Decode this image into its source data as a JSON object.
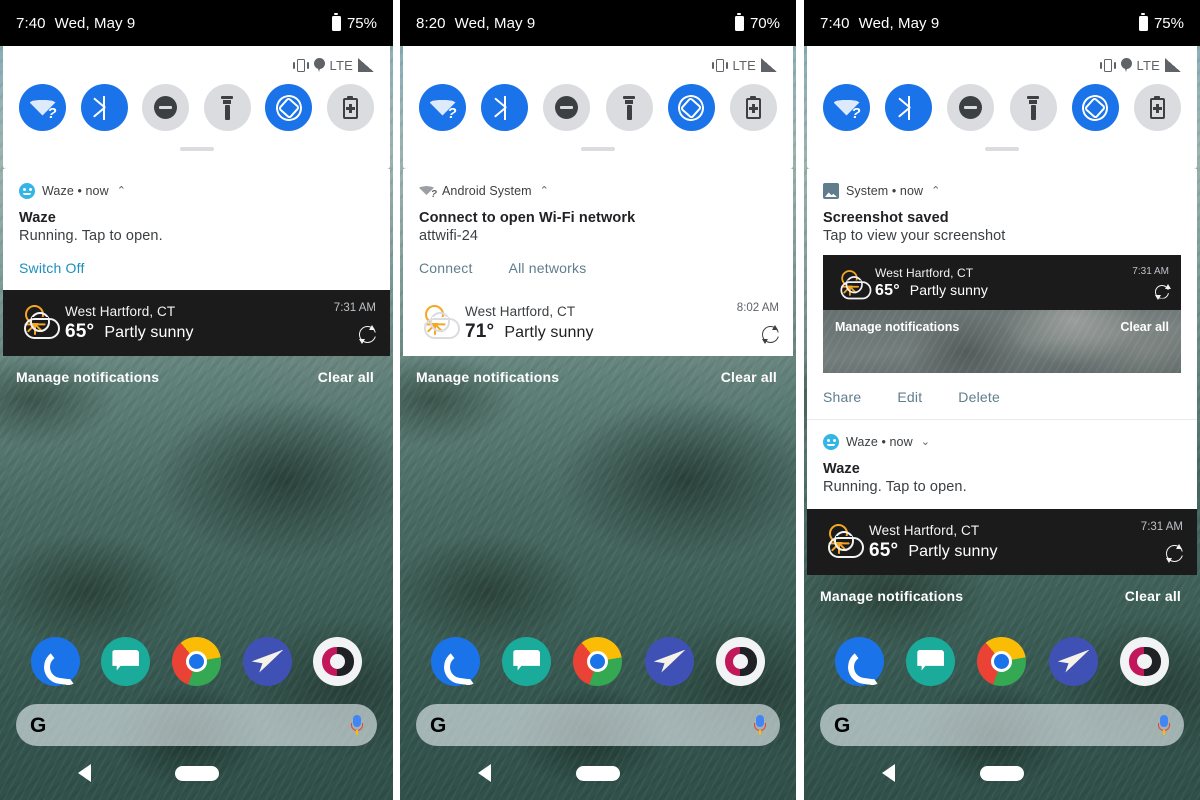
{
  "panels": [
    {
      "id": "panel-1",
      "status_bar": {
        "time": "7:40",
        "date": "Wed, May 9",
        "battery": "75%"
      },
      "quick_settings": {
        "status_icons": {
          "lte_label": "LTE",
          "icons": [
            "vibrate-icon",
            "location-pin-icon",
            "signal-bars-icon"
          ]
        },
        "tiles": [
          {
            "name": "wifi-tile",
            "state": "on",
            "icon": "wifi-question-icon"
          },
          {
            "name": "bluetooth-tile",
            "state": "on",
            "icon": "bluetooth-icon"
          },
          {
            "name": "do-not-disturb-tile",
            "state": "off",
            "icon": "do-not-disturb-icon"
          },
          {
            "name": "flashlight-tile",
            "state": "off",
            "icon": "flashlight-icon"
          },
          {
            "name": "auto-rotate-tile",
            "state": "on",
            "icon": "auto-rotate-icon"
          },
          {
            "name": "battery-saver-tile",
            "state": "off",
            "icon": "battery-plus-icon"
          }
        ]
      },
      "notifications": [
        {
          "app": "Waze • now",
          "app_icon": "waze-icon",
          "chevron": "⌃",
          "title": "Waze",
          "body": "Running. Tap to open.",
          "actions": [
            {
              "label": "Switch Off",
              "accent": "#1a8fbf"
            }
          ]
        }
      ],
      "weather": {
        "location": "West Hartford, CT",
        "temp": "65°",
        "condition": "Partly sunny",
        "time": "7:31 AM",
        "theme": "dark",
        "refresh_icon": "refresh-icon"
      },
      "footer": {
        "manage": "Manage notifications",
        "clear": "Clear all"
      }
    },
    {
      "id": "panel-2",
      "status_bar": {
        "time": "8:20",
        "date": "Wed, May 9",
        "battery": "70%"
      },
      "quick_settings": {
        "status_icons": {
          "lte_label": "LTE",
          "icons": [
            "vibrate-icon",
            "signal-bars-icon"
          ]
        },
        "tiles": [
          {
            "name": "wifi-tile",
            "state": "on",
            "icon": "wifi-question-icon"
          },
          {
            "name": "bluetooth-tile",
            "state": "on",
            "icon": "bluetooth-icon"
          },
          {
            "name": "do-not-disturb-tile",
            "state": "off",
            "icon": "do-not-disturb-icon"
          },
          {
            "name": "flashlight-tile",
            "state": "off",
            "icon": "flashlight-icon"
          },
          {
            "name": "auto-rotate-tile",
            "state": "on",
            "icon": "auto-rotate-icon"
          },
          {
            "name": "battery-saver-tile",
            "state": "off",
            "icon": "battery-plus-icon"
          }
        ]
      },
      "notifications": [
        {
          "app": "Android System",
          "app_icon": "wifi-question-small-icon",
          "chevron": "⌃",
          "title": "Connect to open Wi-Fi network",
          "body": "attwifi-24",
          "actions": [
            {
              "label": "Connect",
              "accent": "#5f7d8c"
            },
            {
              "label": "All networks",
              "accent": "#5f7d8c"
            }
          ]
        }
      ],
      "weather": {
        "location": "West Hartford, CT",
        "temp": "71°",
        "condition": "Partly sunny",
        "time": "8:02 AM",
        "theme": "light",
        "refresh_icon": "refresh-icon"
      },
      "footer": {
        "manage": "Manage notifications",
        "clear": "Clear all"
      }
    },
    {
      "id": "panel-3",
      "status_bar": {
        "time": "7:40",
        "date": "Wed, May 9",
        "battery": "75%"
      },
      "quick_settings": {
        "status_icons": {
          "lte_label": "LTE",
          "icons": [
            "vibrate-icon",
            "location-pin-icon",
            "signal-bars-icon"
          ]
        },
        "tiles": [
          {
            "name": "wifi-tile",
            "state": "on",
            "icon": "wifi-question-icon"
          },
          {
            "name": "bluetooth-tile",
            "state": "on",
            "icon": "bluetooth-icon"
          },
          {
            "name": "do-not-disturb-tile",
            "state": "off",
            "icon": "do-not-disturb-icon"
          },
          {
            "name": "flashlight-tile",
            "state": "off",
            "icon": "flashlight-icon"
          },
          {
            "name": "auto-rotate-tile",
            "state": "on",
            "icon": "auto-rotate-icon"
          },
          {
            "name": "battery-saver-tile",
            "state": "off",
            "icon": "battery-plus-icon"
          }
        ]
      },
      "notifications": [
        {
          "app": "System • now",
          "app_icon": "image-icon",
          "chevron": "⌃",
          "title": "Screenshot saved",
          "body": "Tap to view your screenshot",
          "actions": [
            {
              "label": "Share",
              "accent": "#5f7d8c"
            },
            {
              "label": "Edit",
              "accent": "#5f7d8c"
            },
            {
              "label": "Delete",
              "accent": "#5f7d8c"
            }
          ],
          "preview": {
            "weather": {
              "location": "West Hartford, CT",
              "temp": "65°",
              "condition": "Partly sunny",
              "time": "7:31 AM"
            },
            "footer": {
              "manage": "Manage notifications",
              "clear": "Clear all"
            }
          }
        },
        {
          "app": "Waze • now",
          "app_icon": "waze-icon",
          "chevron": "⌄",
          "title": "Waze",
          "body": "Running. Tap to open.",
          "actions": []
        }
      ],
      "weather": {
        "location": "West Hartford, CT",
        "temp": "65°",
        "condition": "Partly sunny",
        "time": "7:31 AM",
        "theme": "dark",
        "refresh_icon": "refresh-icon"
      },
      "footer": {
        "manage": "Manage notifications",
        "clear": "Clear all"
      }
    }
  ],
  "home": {
    "dock_apps": [
      "phone-icon",
      "messages-icon",
      "chrome-icon",
      "gmail-send-icon",
      "photos-icon"
    ],
    "search": {
      "logo": "G",
      "mic_icon": "microphone-icon"
    },
    "nav": {
      "back": "back-icon",
      "home": "home-pill-icon"
    }
  },
  "colors": {
    "accent_blue": "#1a73e8",
    "link_blue": "#1a8fbf",
    "muted_link": "#5f7d8c",
    "weather_orange": "#f5a623"
  }
}
